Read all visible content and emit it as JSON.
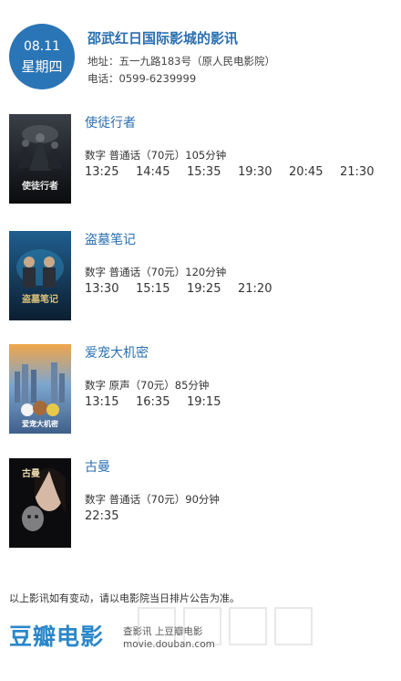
{
  "header": {
    "date": "08.11",
    "weekday": "星期四",
    "cinema_name": "邵武红日国际影城的影讯",
    "address": "地址：五一九路183号（原人民电影院）",
    "phone": "电话：0599-6239999"
  },
  "movies": [
    {
      "title": "使徒行者",
      "info": "数字 普通话（70元）105分钟",
      "times": [
        "13:25",
        "14:45",
        "15:35",
        "19:30",
        "20:45",
        "21:30"
      ],
      "poster_text": "使徒行者"
    },
    {
      "title": "盗墓笔记",
      "info": "数字 普通话（70元）120分钟",
      "times": [
        "13:30",
        "15:15",
        "19:25",
        "21:20"
      ],
      "poster_text": "盗墓笔记"
    },
    {
      "title": "爱宠大机密",
      "info": "数字 原声（70元）85分钟",
      "times": [
        "13:15",
        "16:35",
        "19:15"
      ],
      "poster_text": "爱宠大机密"
    },
    {
      "title": "古曼",
      "info": "数字 普通话（70元）90分钟",
      "times": [
        "22:35"
      ],
      "poster_text": "古曼"
    }
  ],
  "notice": "以上影讯如有变动，请以电影院当日排片公告为准。",
  "footer": {
    "logo": "豆瓣电影",
    "line1": "查影讯 上豆瓣电影",
    "line2": "movie.douban.com"
  },
  "colors": {
    "accent": "#2a75b6",
    "title_blue": "#2a6fb0",
    "logo_blue": "#2b87c9"
  }
}
